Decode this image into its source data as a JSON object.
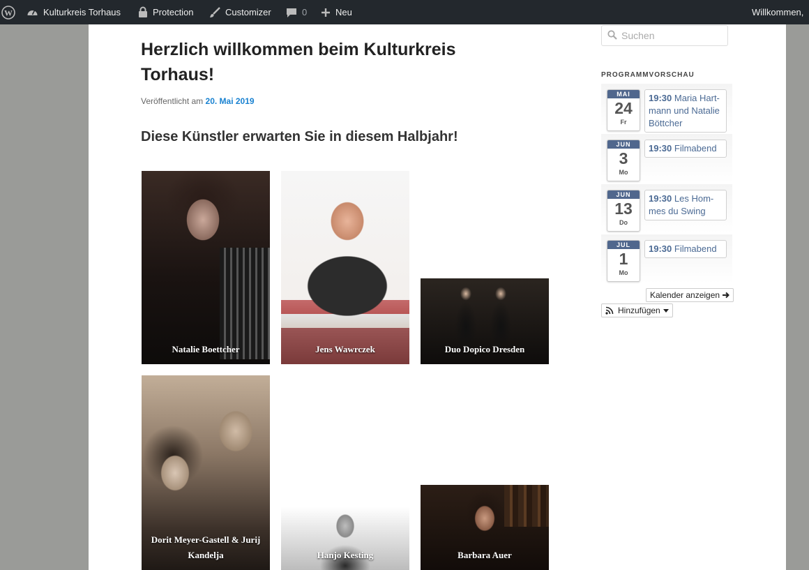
{
  "admin_bar": {
    "site_name": "Kulturkreis Torhaus",
    "protection": "Protection",
    "customizer": "Customizer",
    "comments_count": "0",
    "new": "Neu",
    "greeting": "Willkommen, "
  },
  "post": {
    "title": "Herzlich willkommen beim Kulturkreis Torhaus!",
    "meta_prefix": "Veröffentlicht am",
    "date": "20. Mai 2019",
    "subheading": "Diese Künstler erwarten Sie in diesem Halbjahr!"
  },
  "gallery": [
    {
      "caption": "Natalie Boettcher"
    },
    {
      "caption": "Jens Wawrczek"
    },
    {
      "caption": "Duo Dopico Dresden"
    },
    {
      "caption": "Dorit Meyer-Gastell & Jurij Kandelja"
    },
    {
      "caption": "Hanjo Kesting"
    },
    {
      "caption": "Barbara Auer"
    }
  ],
  "sidebar": {
    "search_placeholder": "Suchen",
    "widget_title": "PROGRAMMVORSCHAU",
    "events": [
      {
        "month": "MAI",
        "day": "24",
        "weekday": "Fr",
        "time": "19:30",
        "title": "Maria Hart-mann und Natalie Böttcher"
      },
      {
        "month": "JUN",
        "day": "3",
        "weekday": "Mo",
        "time": "19:30",
        "title": "Filmabend"
      },
      {
        "month": "JUN",
        "day": "13",
        "weekday": "Do",
        "time": "19:30",
        "title": "Les Hom-mes du Swing"
      },
      {
        "month": "JUL",
        "day": "1",
        "weekday": "Mo",
        "time": "19:30",
        "title": "Filmabend"
      }
    ],
    "calendar_button": "Kalender anzeigen",
    "add_button": "Hinzufügen"
  },
  "colors": {
    "admin_bg": "#23282d",
    "link_blue": "#1982d1",
    "month_bar": "#50678d",
    "event_link": "#4b6a94"
  }
}
